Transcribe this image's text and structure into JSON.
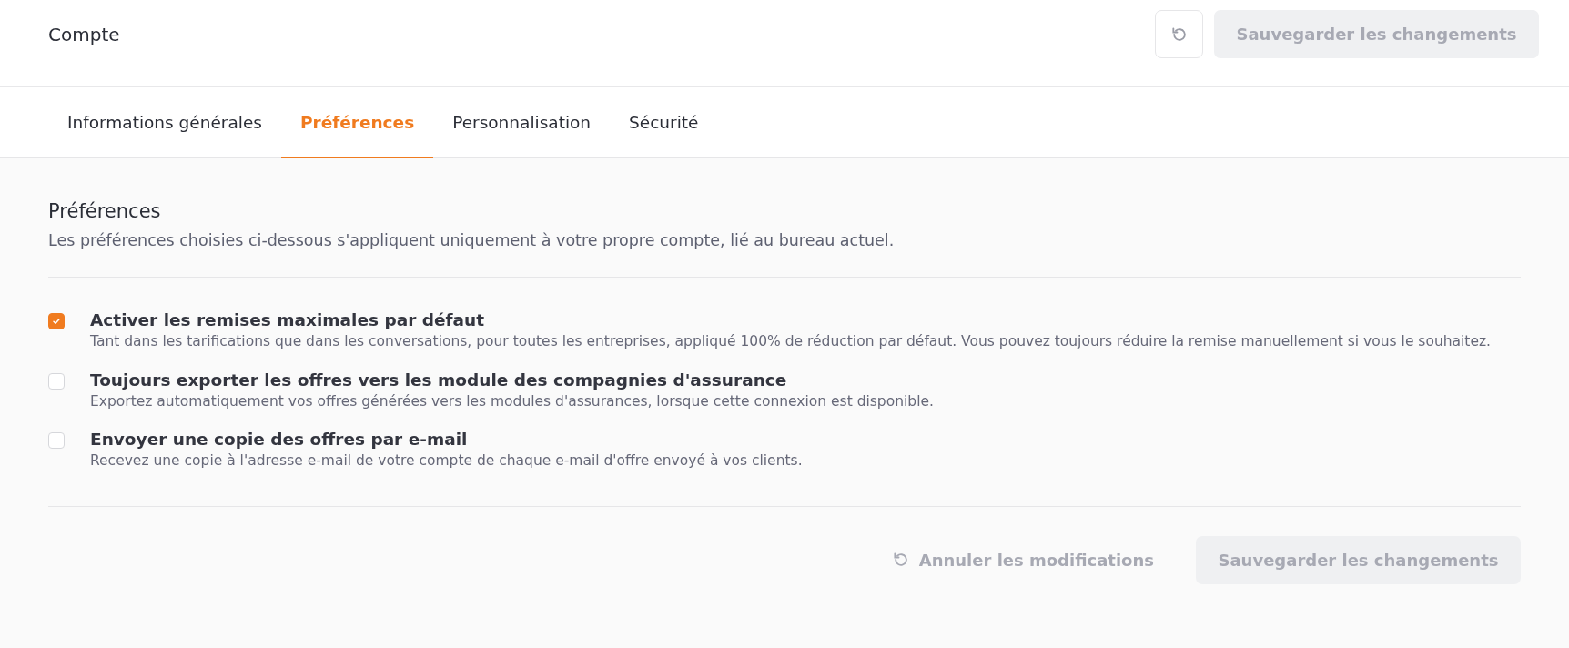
{
  "header": {
    "title": "Compte",
    "reset_button": {
      "disabled": true
    },
    "save_button": {
      "label": "Sauvegarder les changements",
      "disabled": true
    }
  },
  "tabs": [
    {
      "label": "Informations générales",
      "selected": false
    },
    {
      "label": "Préférences",
      "selected": true
    },
    {
      "label": "Personnalisation",
      "selected": false
    },
    {
      "label": "Sécurité",
      "selected": false
    }
  ],
  "section": {
    "title": "Préférences",
    "description": "Les préférences choisies ci-dessous s'appliquent uniquement à votre propre compte, lié au bureau actuel."
  },
  "options": [
    {
      "label": "Activer les remises maximales par défaut",
      "description": "Tant dans les tarifications que dans les conversations, pour toutes les entreprises, appliqué 100% de réduction par défaut. Vous pouvez toujours réduire la remise manuellement si vous le souhaitez.",
      "checked": true
    },
    {
      "label": "Toujours exporter les offres vers les module des compagnies d'assurance",
      "description": "Exportez automatiquement vos offres générées vers les modules d'assurances, lorsque cette connexion est disponible.",
      "checked": false
    },
    {
      "label": "Envoyer une copie des offres par e-mail",
      "description": "Recevez une copie à l'adresse e-mail de votre compte de chaque e-mail d'offre envoyé à vos clients.",
      "checked": false
    }
  ],
  "footer": {
    "cancel_button": {
      "label": "Annuler les modifications",
      "disabled": true
    },
    "save_button": {
      "label": "Sauvegarder les changements",
      "disabled": true
    }
  }
}
